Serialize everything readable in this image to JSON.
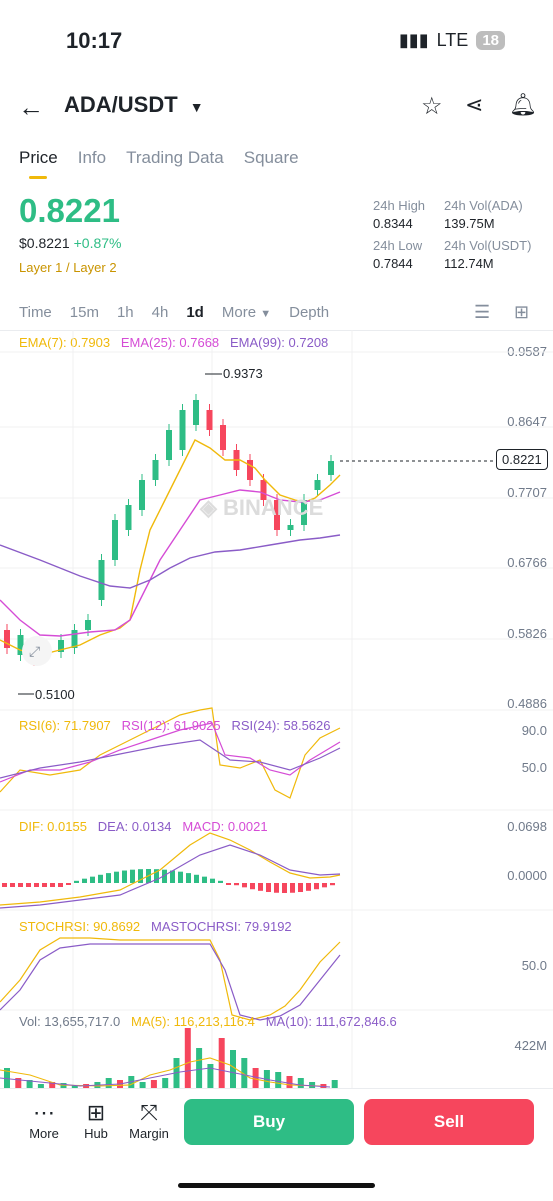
{
  "status": {
    "time": "10:17",
    "network": "LTE",
    "battery": "18"
  },
  "header": {
    "pair": "ADA/USDT"
  },
  "tabs": [
    {
      "label": "Price"
    },
    {
      "label": "Info"
    },
    {
      "label": "Trading Data"
    },
    {
      "label": "Square"
    }
  ],
  "price": {
    "last": "0.8221",
    "usd": "$0.8221",
    "change": "+0.87%",
    "tag": "Layer 1 / Layer 2"
  },
  "stats": {
    "high_label": "24h High",
    "high": "0.8344",
    "vol_base_label": "24h Vol(ADA)",
    "vol_base": "139.75M",
    "low_label": "24h Low",
    "low": "0.7844",
    "vol_quote_label": "24h Vol(USDT)",
    "vol_quote": "112.74M"
  },
  "intervals": [
    {
      "label": "Time"
    },
    {
      "label": "15m"
    },
    {
      "label": "1h"
    },
    {
      "label": "4h"
    },
    {
      "label": "1d"
    },
    {
      "label": "More"
    },
    {
      "label": "Depth"
    }
  ],
  "ema": {
    "ema7": "EMA(7): 0.7903",
    "ema25": "EMA(25): 0.7668",
    "ema99": "EMA(99): 0.7208"
  },
  "price_axis": [
    "0.9587",
    "0.8647",
    "0.7707",
    "0.6766",
    "0.5826",
    "0.4886"
  ],
  "markers": {
    "high": "0.9373",
    "low": "0.5100",
    "current": "0.8221"
  },
  "rsi": {
    "rsi6": "RSI(6): 71.7907",
    "rsi12": "RSI(12): 61.9025",
    "rsi24": "RSI(24): 58.5626",
    "axis": [
      "90.0",
      "50.0"
    ]
  },
  "macd": {
    "dif": "DIF: 0.0155",
    "dea": "DEA: 0.0134",
    "macd": "MACD: 0.0021",
    "axis": [
      "0.0698",
      "0.0000"
    ]
  },
  "stoch": {
    "k": "STOCHRSI: 90.8692",
    "d": "MASTOCHRSI: 79.9192",
    "axis": [
      "50.0"
    ]
  },
  "vol": {
    "vol": "Vol: 13,655,717.0",
    "ma5": "MA(5): 116,213,116.4",
    "ma10": "MA(10): 111,672,846.6",
    "axis": [
      "422M"
    ]
  },
  "bottom": {
    "more": "More",
    "hub": "Hub",
    "margin": "Margin",
    "buy": "Buy",
    "sell": "Sell"
  },
  "colors": {
    "up": "#2ebd85",
    "down": "#f6465d",
    "ema7": "#f0b90b",
    "ema25": "#d54cd6",
    "ema99": "#8a5cc7"
  }
}
